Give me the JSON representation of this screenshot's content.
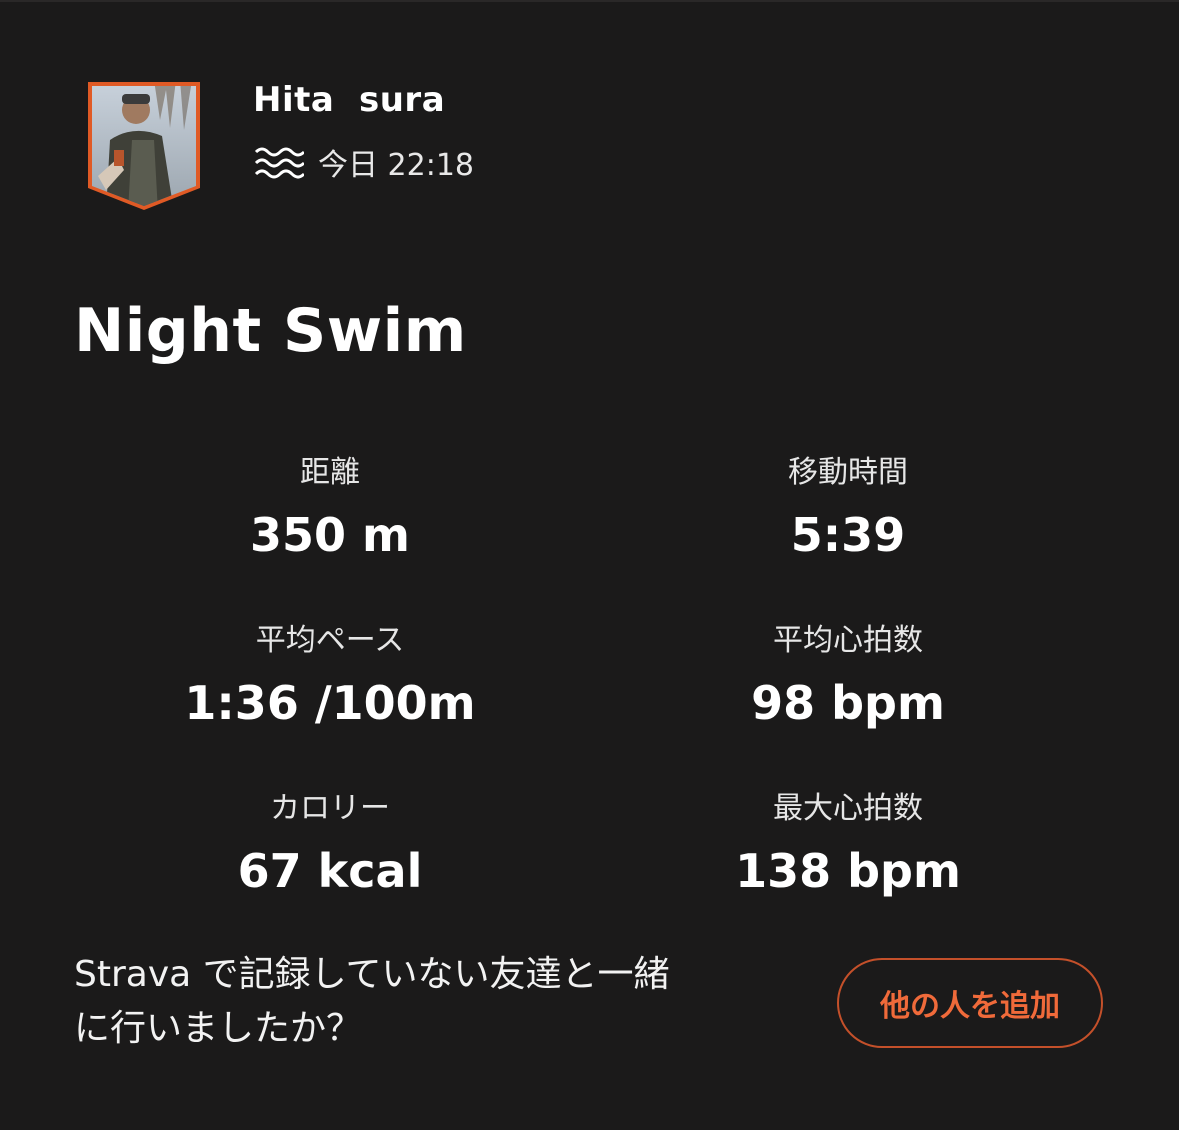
{
  "header": {
    "athlete_name": "Hita  sura",
    "activity_type_icon": "swim-icon",
    "timestamp": "今日 22:18",
    "avatar_icon": "athlete-avatar-shield"
  },
  "activity": {
    "title": "Night Swim"
  },
  "stats": [
    {
      "label": "距離",
      "value": "350 m"
    },
    {
      "label": "移動時間",
      "value": "5:39"
    },
    {
      "label": "平均ペース",
      "value": "1:36 /100m"
    },
    {
      "label": "平均心拍数",
      "value": "98 bpm"
    },
    {
      "label": "カロリー",
      "value": "67 kcal"
    },
    {
      "label": "最大心拍数",
      "value": "138 bpm"
    }
  ],
  "footer": {
    "prompt_line1": "Strava で記録していない友達と一緒",
    "prompt_line2": "に行いましたか？",
    "add_button_label": "他の人を追加"
  },
  "colors": {
    "background": "#1b1a1a",
    "accent": "#f06a3a",
    "button_border": "#c4502a",
    "text": "#ffffff"
  }
}
